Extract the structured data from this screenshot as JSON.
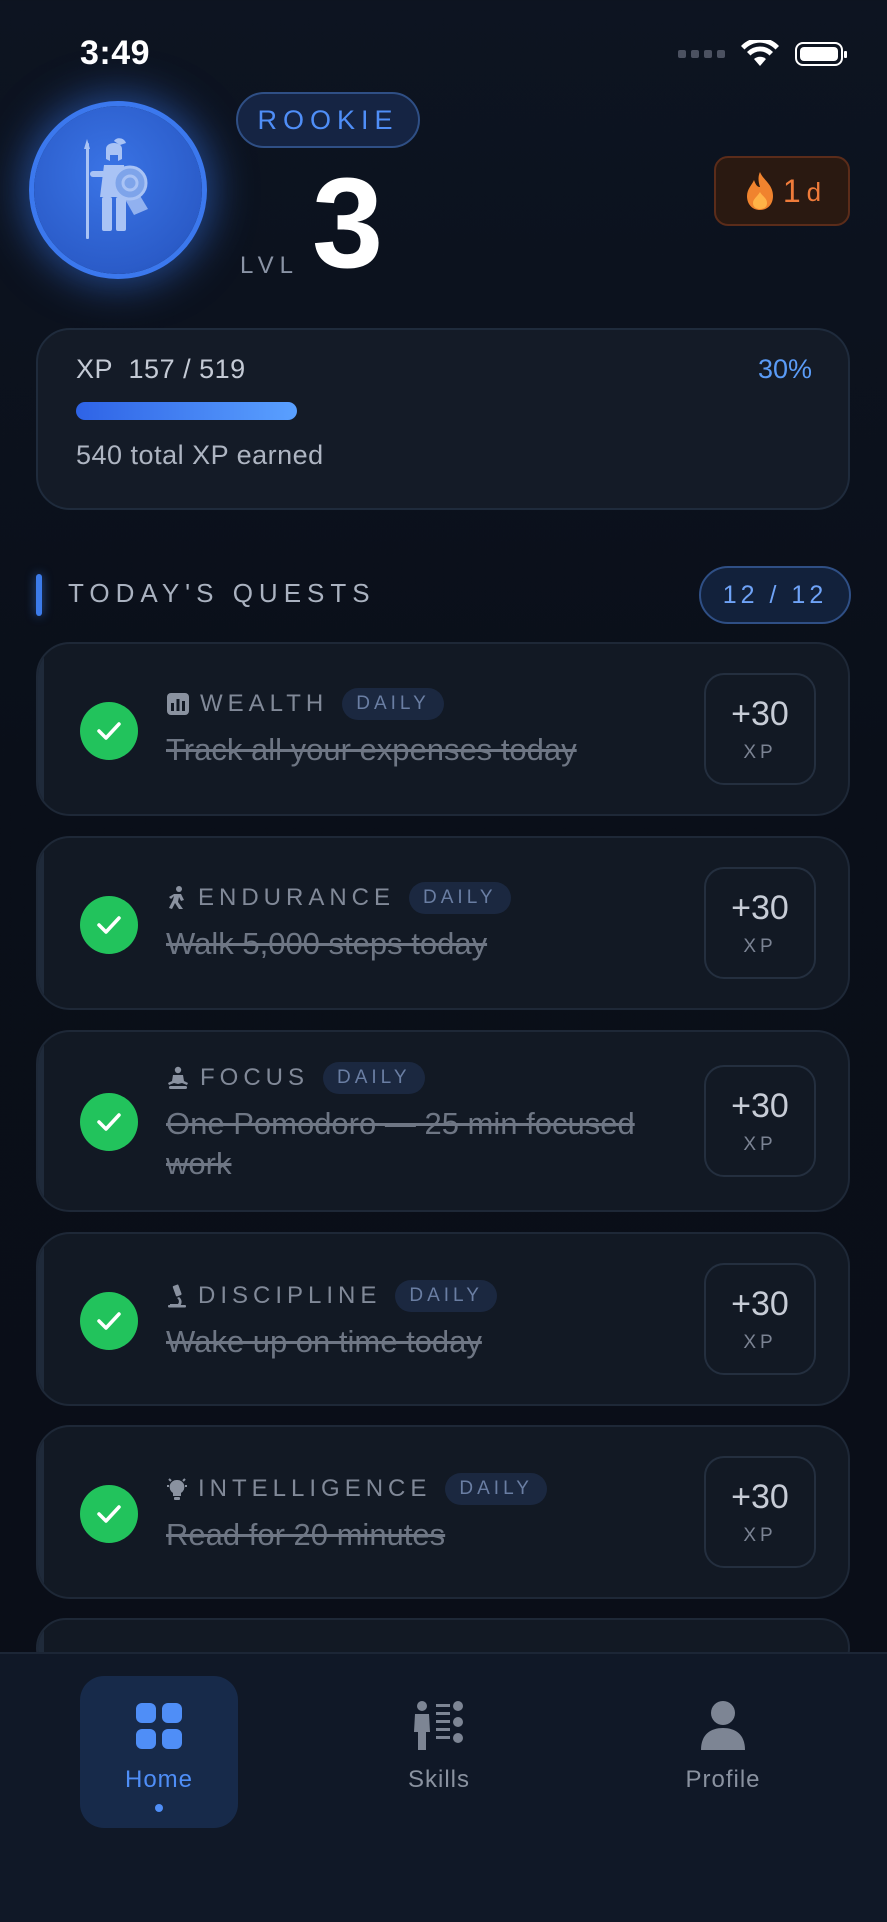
{
  "status_bar": {
    "time": "3:49"
  },
  "header": {
    "rank": "ROOKIE",
    "level_label": "LVL",
    "level": "3",
    "streak_count": "1",
    "streak_unit": "d"
  },
  "xp": {
    "label": "XP  157 / 519",
    "percent_label": "30%",
    "progress_fraction": 0.3,
    "total_earned": "540 total XP earned"
  },
  "quests": {
    "title": "TODAY'S QUESTS",
    "count": "12 / 12",
    "items": [
      {
        "category": "WEALTH",
        "tag": "DAILY",
        "text": "Track all your expenses today",
        "xp": "+30",
        "xp_unit": "XP",
        "icon": "wealth-chart-icon",
        "completed": true
      },
      {
        "category": "ENDURANCE",
        "tag": "DAILY",
        "text": "Walk 5,000 steps today",
        "xp": "+30",
        "xp_unit": "XP",
        "icon": "runner-icon",
        "completed": true
      },
      {
        "category": "FOCUS",
        "tag": "DAILY",
        "text": "One Pomodoro — 25 min focused work",
        "xp": "+30",
        "xp_unit": "XP",
        "icon": "meditation-icon",
        "completed": true
      },
      {
        "category": "DISCIPLINE",
        "tag": "DAILY",
        "text": "Wake up on time today",
        "xp": "+30",
        "xp_unit": "XP",
        "icon": "microscope-icon",
        "completed": true
      },
      {
        "category": "INTELLIGENCE",
        "tag": "DAILY",
        "text": "Read for 20 minutes",
        "xp": "+30",
        "xp_unit": "XP",
        "icon": "lightbulb-icon",
        "completed": true
      }
    ]
  },
  "nav": {
    "home": "Home",
    "skills": "Skills",
    "profile": "Profile"
  },
  "colors": {
    "accent": "#4f8ef7",
    "success": "#22c35c",
    "streak": "#ef7b3a",
    "background": "#0b111b"
  }
}
